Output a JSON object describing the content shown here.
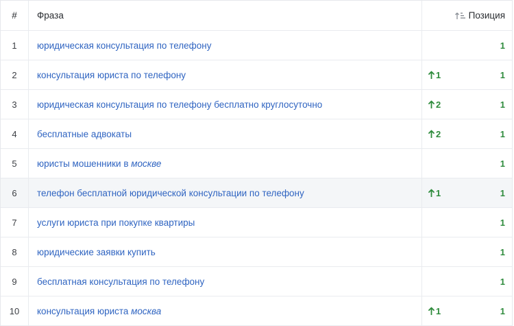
{
  "header": {
    "num": "#",
    "phrase": "Фраза",
    "position": "Позиция"
  },
  "rows": [
    {
      "num": "1",
      "phrase": "юридическая консультация по телефону",
      "phrase_em": "",
      "change": "",
      "position": "1"
    },
    {
      "num": "2",
      "phrase": "консультация юриста по телефону",
      "phrase_em": "",
      "change": "1",
      "position": "1"
    },
    {
      "num": "3",
      "phrase": "юридическая консультация по телефону бесплатно круглосуточно",
      "phrase_em": "",
      "change": "2",
      "position": "1"
    },
    {
      "num": "4",
      "phrase": "бесплатные адвокаты",
      "phrase_em": "",
      "change": "2",
      "position": "1"
    },
    {
      "num": "5",
      "phrase": "юристы мошенники в ",
      "phrase_em": "москве",
      "change": "",
      "position": "1"
    },
    {
      "num": "6",
      "phrase": "телефон бесплатной юридической консультации по телефону",
      "phrase_em": "",
      "change": "1",
      "position": "1"
    },
    {
      "num": "7",
      "phrase": "услуги юриста при покупке квартиры",
      "phrase_em": "",
      "change": "",
      "position": "1"
    },
    {
      "num": "8",
      "phrase": "юридические заявки купить",
      "phrase_em": "",
      "change": "",
      "position": "1"
    },
    {
      "num": "9",
      "phrase": "бесплатная консультация по телефону",
      "phrase_em": "",
      "change": "",
      "position": "1"
    },
    {
      "num": "10",
      "phrase": "консультация юриста ",
      "phrase_em": "москва",
      "change": "1",
      "position": "1"
    }
  ],
  "colors": {
    "link": "#2f64c1",
    "positive": "#2e8b3c",
    "highlight_row": "#f4f6f8"
  },
  "icons": {
    "sort": "sort-ascending-icon",
    "change_up": "arrow-up-icon"
  }
}
